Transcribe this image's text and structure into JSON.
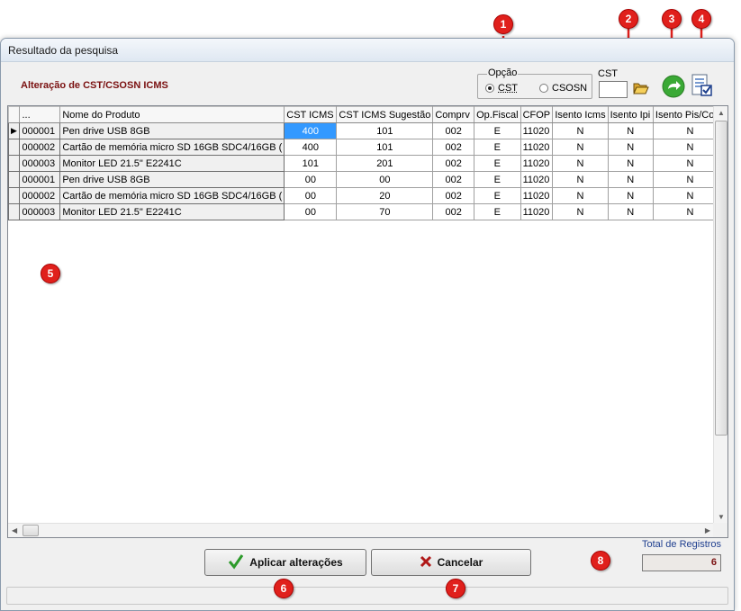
{
  "window": {
    "title": "Resultado da pesquisa"
  },
  "form": {
    "title": "Alteração de CST/CSOSN ICMS"
  },
  "opcao": {
    "legend": "Opção",
    "options": [
      {
        "label": "CST",
        "checked": true
      },
      {
        "label": "CSOSN",
        "checked": false
      }
    ]
  },
  "cst": {
    "label": "CST",
    "value": ""
  },
  "icons": {
    "open_folder": "open-folder-icon",
    "refresh": "refresh-arrow-icon",
    "checklist": "checklist-document-icon"
  },
  "grid": {
    "columns": [
      "...",
      "Nome do Produto",
      "CST ICMS",
      "CST ICMS Sugestão",
      "Comprv",
      "Op.Fiscal",
      "CFOP",
      "Isento Icms",
      "Isento Ipi",
      "Isento Pis/Cofin"
    ],
    "rows": [
      {
        "code": "000001",
        "name": "Pen drive USB 8GB",
        "cst_icms": "400",
        "cst_sugestao": "101",
        "comprv": "002",
        "op_fiscal": "E",
        "cfop": "11020",
        "isento_icms": "N",
        "isento_ipi": "N",
        "isento_pis": "N"
      },
      {
        "code": "000002",
        "name": "Cartão de memória micro SD 16GB SDC4/16GB (",
        "cst_icms": "400",
        "cst_sugestao": "101",
        "comprv": "002",
        "op_fiscal": "E",
        "cfop": "11020",
        "isento_icms": "N",
        "isento_ipi": "N",
        "isento_pis": "N"
      },
      {
        "code": "000003",
        "name": "Monitor LED 21.5\" E2241C",
        "cst_icms": "101",
        "cst_sugestao": "201",
        "comprv": "002",
        "op_fiscal": "E",
        "cfop": "11020",
        "isento_icms": "N",
        "isento_ipi": "N",
        "isento_pis": "N"
      },
      {
        "code": "000001",
        "name": "Pen drive USB 8GB",
        "cst_icms": "00",
        "cst_sugestao": "00",
        "comprv": "002",
        "op_fiscal": "E",
        "cfop": "11020",
        "isento_icms": "N",
        "isento_ipi": "N",
        "isento_pis": "N"
      },
      {
        "code": "000002",
        "name": "Cartão de memória micro SD 16GB SDC4/16GB (",
        "cst_icms": "00",
        "cst_sugestao": "20",
        "comprv": "002",
        "op_fiscal": "E",
        "cfop": "11020",
        "isento_icms": "N",
        "isento_ipi": "N",
        "isento_pis": "N"
      },
      {
        "code": "000003",
        "name": "Monitor LED 21.5\" E2241C",
        "cst_icms": "00",
        "cst_sugestao": "70",
        "comprv": "002",
        "op_fiscal": "E",
        "cfop": "11020",
        "isento_icms": "N",
        "isento_ipi": "N",
        "isento_pis": "N"
      }
    ],
    "selected_row": 0
  },
  "buttons": {
    "apply": {
      "label": "Aplicar alterações",
      "icon": "green-checkmark-icon"
    },
    "cancel": {
      "label": "Cancelar",
      "icon": "red-x-icon"
    }
  },
  "total": {
    "label": "Total de Registros",
    "value": "6"
  },
  "markers": [
    "1",
    "2",
    "3",
    "4",
    "5",
    "6",
    "7",
    "8"
  ],
  "colors": {
    "title_red": "#7a1010",
    "selection_blue": "#3399ff",
    "marker_red": "#e0201c",
    "total_label_blue": "#1f3f8f"
  }
}
